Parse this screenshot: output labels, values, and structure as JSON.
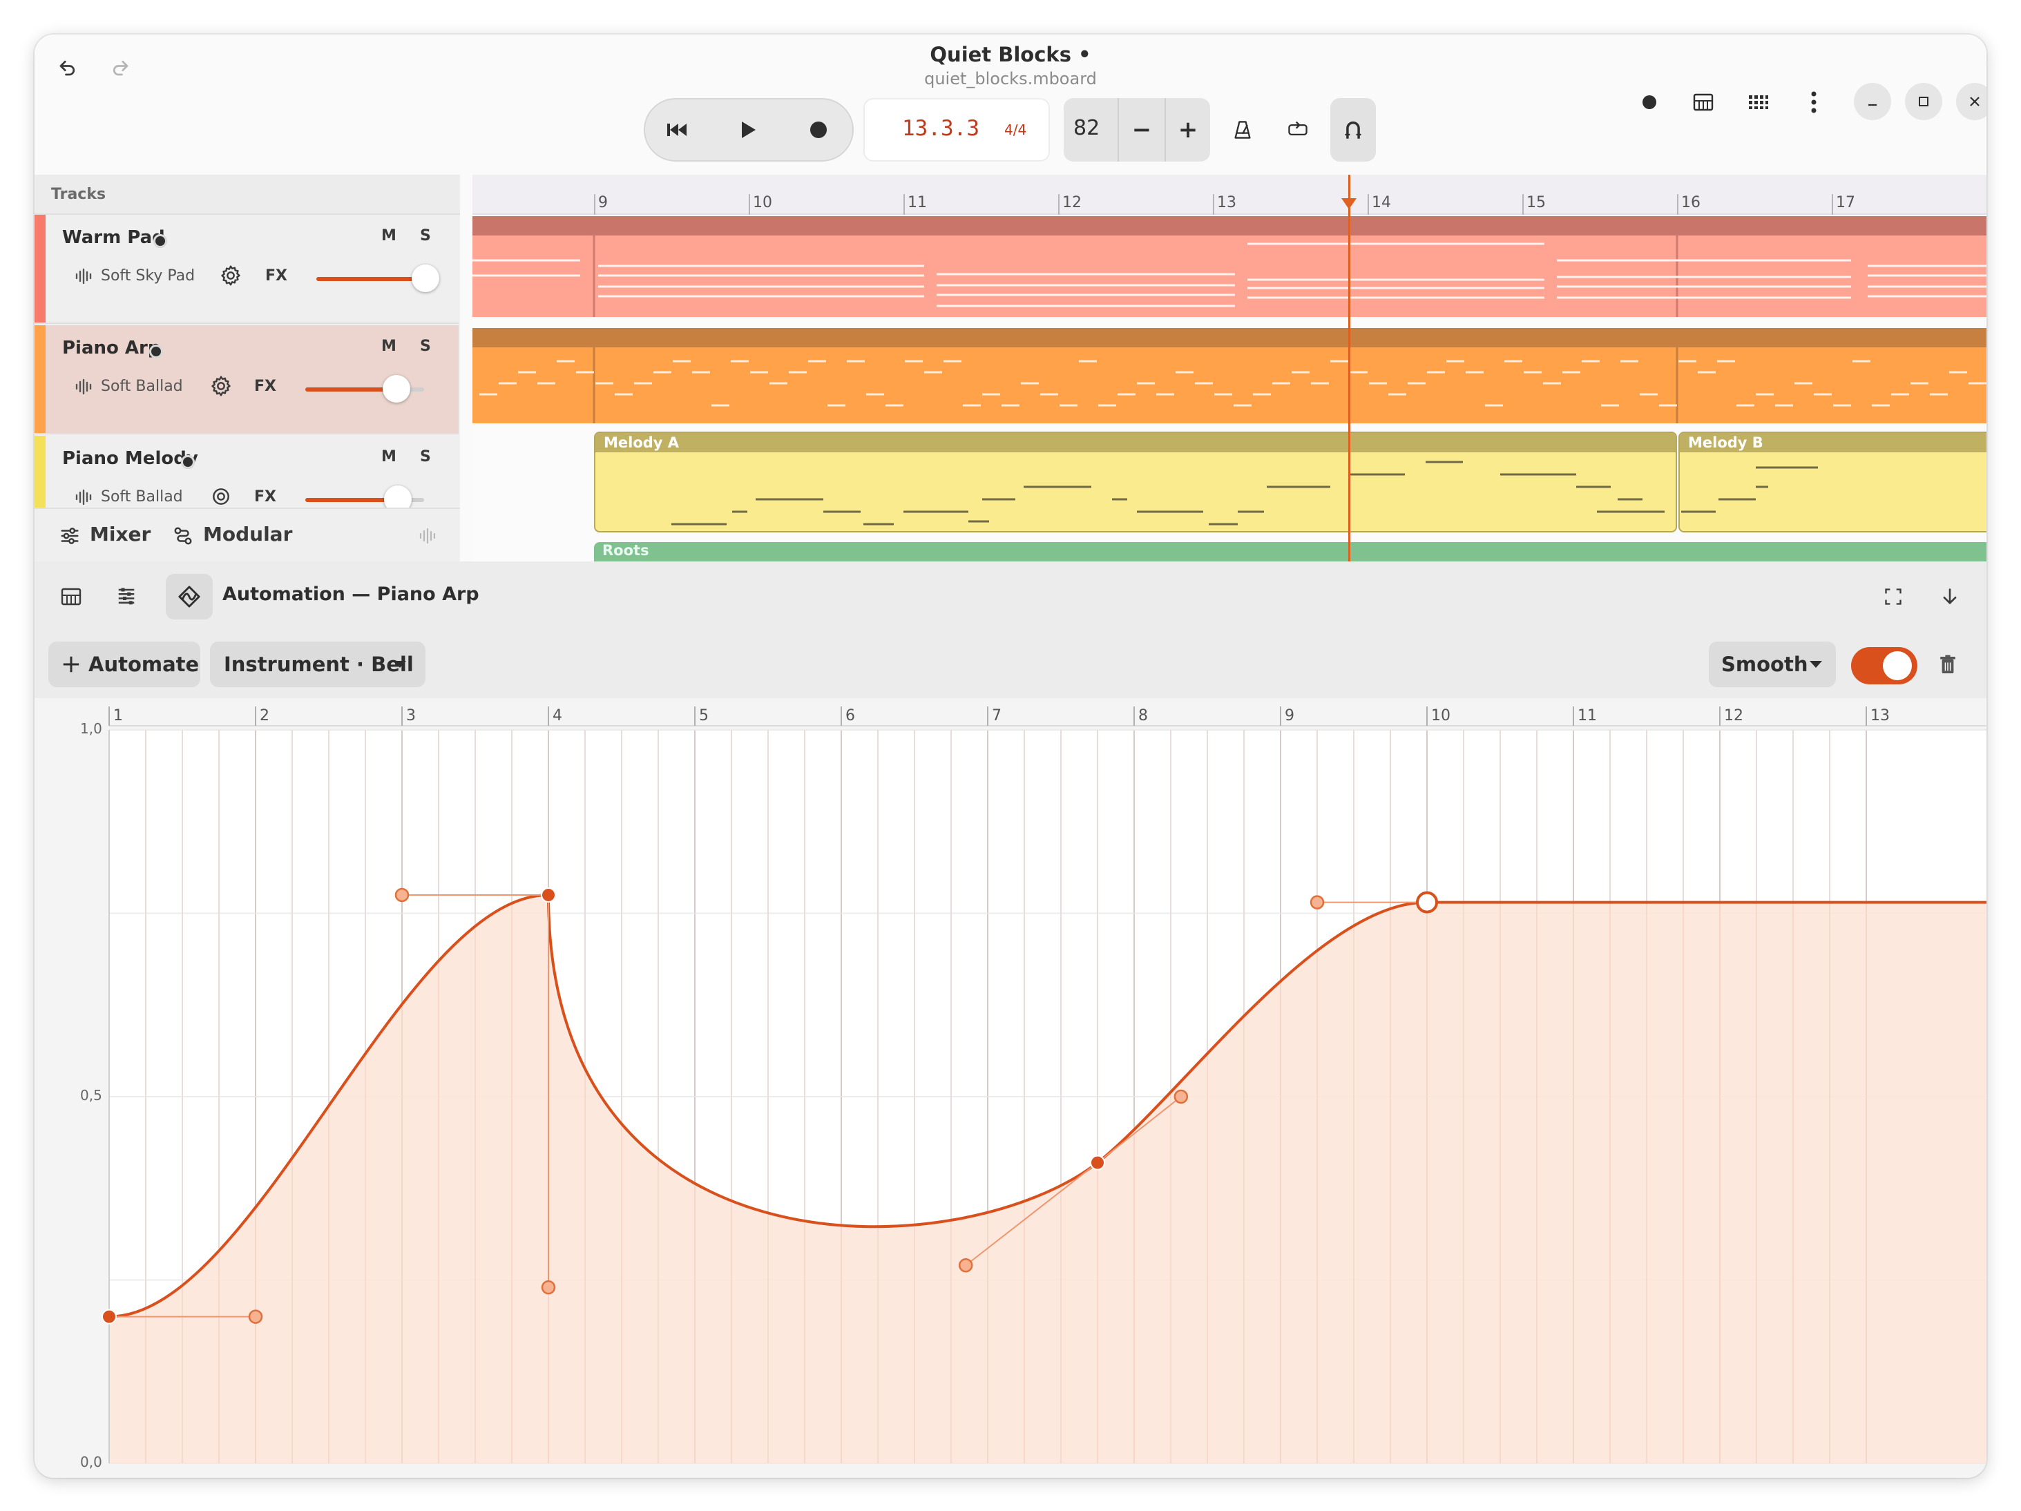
{
  "window": {
    "title": "Quiet Blocks •",
    "subtitle": "quiet_blocks.mboard"
  },
  "header": {
    "undo_icon": "undo-icon",
    "redo_icon": "redo-icon",
    "transport": {
      "rewind_icon": "skip-back-icon",
      "play_icon": "play-icon",
      "record_icon": "record-icon"
    },
    "position": "13.3.3",
    "time_signature": "4/4",
    "tempo": "82",
    "tempo_decrease": "−",
    "tempo_increase": "+",
    "tools": [
      "metronome-icon",
      "loop-icon",
      "magnet-icon"
    ],
    "right_icons": [
      "record-dot-icon",
      "piano-icon",
      "grid-icon",
      "more-vertical-icon"
    ],
    "window_controls": [
      "minimize-icon",
      "maximize-icon",
      "close-icon"
    ]
  },
  "tracks_panel": {
    "header": "Tracks",
    "mute_label": "M",
    "solo_label": "S",
    "fx_label": "FX",
    "tracks": [
      {
        "name": "Warm Pad",
        "instrument": "Soft Sky Pad",
        "color": "#f87a6b",
        "volume": 0.96
      },
      {
        "name": "Piano Arp",
        "instrument": "Soft Ballad",
        "color": "#ffa24a",
        "volume": 0.8
      },
      {
        "name": "Piano Melody",
        "instrument": "Soft Ballad",
        "color": "#f5e05a",
        "volume": 0.82
      }
    ],
    "footer": {
      "mixer": "Mixer",
      "modular": "Modular"
    }
  },
  "arrangement": {
    "bars": [
      "9",
      "10",
      "11",
      "12",
      "13",
      "14",
      "15",
      "16",
      "17"
    ],
    "clips": {
      "melody_a": "Melody A",
      "melody_b": "Melody B",
      "roots": "Roots"
    },
    "playhead_bar": 13.8
  },
  "editor": {
    "title": "Automation — Piano Arp",
    "automate_button": "Automate",
    "parameter": "Instrument · Bell",
    "curve_mode": "Smooth",
    "enabled": true,
    "colors": {
      "accent": "#d9501c",
      "fill": "#fde5da"
    }
  },
  "chart_data": {
    "type": "area",
    "x_labels": [
      "1",
      "2",
      "3",
      "4",
      "5",
      "6",
      "7",
      "8",
      "9",
      "10",
      "11",
      "12",
      "13"
    ],
    "y_labels": [
      "1,0",
      "0,5",
      "0,0"
    ],
    "xlim": [
      1,
      13.1
    ],
    "ylim": [
      0,
      1
    ],
    "points": [
      {
        "x": 1.0,
        "y": 0.2,
        "h_out": [
          2.0,
          0.2
        ]
      },
      {
        "x": 4.0,
        "y": 0.775,
        "h_in": [
          3.0,
          0.775
        ],
        "h_out": [
          4.0,
          0.24
        ]
      },
      {
        "x": 7.75,
        "y": 0.41,
        "h_in": [
          6.85,
          0.27
        ],
        "h_out": [
          8.32,
          0.5
        ]
      },
      {
        "x": 10.0,
        "y": 0.765,
        "h_in": [
          9.25,
          0.765
        ],
        "selected": true
      }
    ],
    "grid": true
  }
}
